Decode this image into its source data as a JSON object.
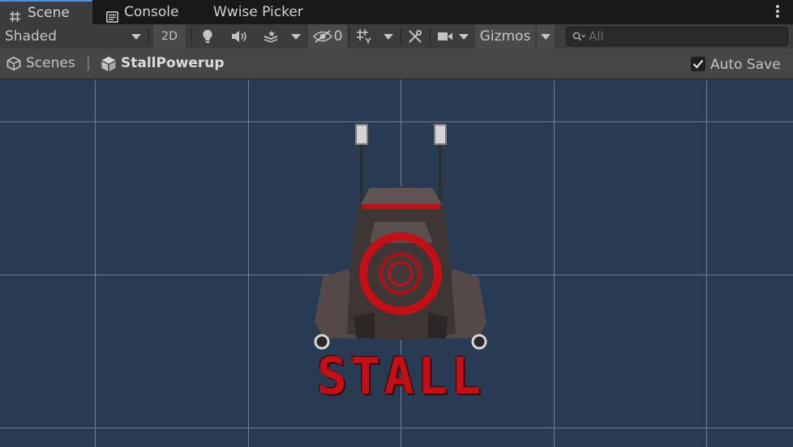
{
  "tabs": [
    {
      "label": "Scene",
      "icon": "grid-icon",
      "active": true
    },
    {
      "label": "Console",
      "icon": "console-icon",
      "active": false
    },
    {
      "label": "Wwise Picker",
      "icon": "",
      "active": false
    }
  ],
  "toolbar": {
    "shading_mode": "Shaded",
    "mode_2d": "2D",
    "hidden_count": "0",
    "gizmos_label": "Gizmos",
    "search_placeholder": "All"
  },
  "breadcrumb": {
    "root": "Scenes",
    "current": "StallPowerup"
  },
  "auto_save": {
    "label": "Auto Save",
    "checked": true
  },
  "scene": {
    "sprite_text": "STALL"
  },
  "colors": {
    "tab_bar": "#191919",
    "toolbar": "#3c3c3c",
    "breadcrumb_bar": "#464646",
    "scene_background": "#283b53",
    "grid_line": "#6e8197",
    "accent_red": "#c40f17",
    "active_tab_highlight": "#4d8ed8"
  }
}
